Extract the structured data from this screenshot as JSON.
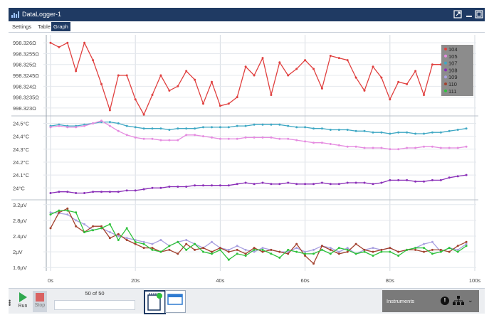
{
  "window": {
    "title": "DataLogger-1"
  },
  "tabs": [
    {
      "label": "Settings"
    },
    {
      "label": "Table"
    },
    {
      "label": "Graph"
    }
  ],
  "legend": {
    "entries": [
      {
        "id": "104",
        "color": "#e0403f"
      },
      {
        "id": "105",
        "color": "#e58ce0"
      },
      {
        "id": "107",
        "color": "#3fa8c4"
      },
      {
        "id": "108",
        "color": "#8a2fb8"
      },
      {
        "id": "109",
        "color": "#a9a0e0"
      },
      {
        "id": "110",
        "color": "#a3422f"
      },
      {
        "id": "111",
        "color": "#2ec23b"
      }
    ]
  },
  "bottom": {
    "run_label": "Run",
    "stop_label": "Stop",
    "count_text": "50 of 50",
    "instruments_label": "Instruments"
  },
  "chart_data": [
    {
      "type": "line",
      "ylabels": [
        "998.326Ω",
        "998.3255Ω",
        "998.325Ω",
        "998.3245Ω",
        "998.324Ω",
        "998.3235Ω",
        "998.323Ω"
      ],
      "ylim": [
        998.3228,
        998.3263
      ],
      "series": [
        {
          "name": "104",
          "color": "#e0403f",
          "x": [
            0,
            2,
            4,
            6,
            8,
            10,
            12,
            14,
            16,
            18,
            20,
            22,
            24,
            26,
            28,
            30,
            32,
            34,
            36,
            38,
            40,
            42,
            44,
            46,
            48,
            50,
            52,
            54,
            56,
            58,
            60,
            62,
            64,
            66,
            68,
            70,
            72,
            74,
            76,
            78,
            80,
            82,
            84,
            86,
            88,
            90,
            92,
            94,
            96,
            98
          ],
          "y": [
            998.326,
            998.3258,
            998.326,
            998.3247,
            998.326,
            998.3252,
            998.3241,
            998.3229,
            998.3245,
            998.3245,
            998.3234,
            998.3227,
            998.3236,
            998.3245,
            998.3238,
            998.324,
            998.3247,
            998.3243,
            998.3232,
            998.3242,
            998.3231,
            998.3232,
            998.3235,
            998.3249,
            998.3245,
            998.3253,
            998.3236,
            998.3251,
            998.3245,
            998.3248,
            998.3252,
            998.3248,
            998.3239,
            998.3254,
            998.3253,
            998.3252,
            998.3244,
            998.3238,
            998.3249,
            998.3244,
            998.3234,
            998.3242,
            998.3241,
            998.3247,
            998.3236,
            998.325,
            998.325,
            998.3252,
            998.3253,
            998.3243
          ]
        }
      ]
    },
    {
      "type": "line",
      "ylabels": [
        "24.5°C",
        "24.4°C",
        "24.3°C",
        "24.2°C",
        "24.1°C",
        "24°C"
      ],
      "ylim": [
        23.93,
        24.53
      ],
      "series": [
        {
          "name": "107",
          "color": "#3fa8c4",
          "x": [
            0,
            2,
            4,
            6,
            8,
            10,
            12,
            14,
            16,
            18,
            20,
            22,
            24,
            26,
            28,
            30,
            32,
            34,
            36,
            38,
            40,
            42,
            44,
            46,
            48,
            50,
            52,
            54,
            56,
            58,
            60,
            62,
            64,
            66,
            68,
            70,
            72,
            74,
            76,
            78,
            80,
            82,
            84,
            86,
            88,
            90,
            92,
            94,
            96,
            98
          ],
          "y": [
            24.48,
            24.49,
            24.48,
            24.48,
            24.49,
            24.5,
            24.51,
            24.51,
            24.5,
            24.48,
            24.47,
            24.46,
            24.46,
            24.46,
            24.45,
            24.46,
            24.46,
            24.46,
            24.47,
            24.47,
            24.47,
            24.47,
            24.48,
            24.48,
            24.49,
            24.49,
            24.49,
            24.49,
            24.48,
            24.47,
            24.47,
            24.46,
            24.46,
            24.45,
            24.45,
            24.45,
            24.44,
            24.44,
            24.43,
            24.43,
            24.42,
            24.43,
            24.43,
            24.42,
            24.42,
            24.43,
            24.43,
            24.44,
            24.45,
            24.46
          ]
        },
        {
          "name": "105",
          "color": "#e58ce0",
          "x": [
            0,
            2,
            4,
            6,
            8,
            10,
            12,
            14,
            16,
            18,
            20,
            22,
            24,
            26,
            28,
            30,
            32,
            34,
            36,
            38,
            40,
            42,
            44,
            46,
            48,
            50,
            52,
            54,
            56,
            58,
            60,
            62,
            64,
            66,
            68,
            70,
            72,
            74,
            76,
            78,
            80,
            82,
            84,
            86,
            88,
            90,
            92,
            94,
            96,
            98
          ],
          "y": [
            24.47,
            24.48,
            24.47,
            24.47,
            24.48,
            24.5,
            24.52,
            24.48,
            24.44,
            24.41,
            24.39,
            24.38,
            24.38,
            24.37,
            24.37,
            24.37,
            24.41,
            24.41,
            24.4,
            24.39,
            24.38,
            24.38,
            24.38,
            24.39,
            24.39,
            24.39,
            24.39,
            24.38,
            24.38,
            24.37,
            24.36,
            24.35,
            24.35,
            24.34,
            24.33,
            24.32,
            24.32,
            24.31,
            24.31,
            24.31,
            24.3,
            24.3,
            24.31,
            24.31,
            24.32,
            24.32,
            24.31,
            24.31,
            24.31,
            24.32
          ]
        },
        {
          "name": "108",
          "color": "#8a2fb8",
          "x": [
            0,
            2,
            4,
            6,
            8,
            10,
            12,
            14,
            16,
            18,
            20,
            22,
            24,
            26,
            28,
            30,
            32,
            34,
            36,
            38,
            40,
            42,
            44,
            46,
            48,
            50,
            52,
            54,
            56,
            58,
            60,
            62,
            64,
            66,
            68,
            70,
            72,
            74,
            76,
            78,
            80,
            82,
            84,
            86,
            88,
            90,
            92,
            94,
            96,
            98
          ],
          "y": [
            23.96,
            23.97,
            23.97,
            23.96,
            23.96,
            23.97,
            23.97,
            23.97,
            23.97,
            23.98,
            23.98,
            23.99,
            24.0,
            24.0,
            24.01,
            24.01,
            24.01,
            24.02,
            24.02,
            24.02,
            24.02,
            24.02,
            24.03,
            24.04,
            24.03,
            24.04,
            24.03,
            24.03,
            24.04,
            24.03,
            24.03,
            24.03,
            24.04,
            24.03,
            24.03,
            24.04,
            24.04,
            24.04,
            24.03,
            24.04,
            24.06,
            24.06,
            24.06,
            24.05,
            24.05,
            24.06,
            24.06,
            24.08,
            24.09,
            24.1
          ]
        }
      ]
    },
    {
      "type": "line",
      "ylabels": [
        "3.2µV",
        "2.8µV",
        "2.4µV",
        "2µV",
        "1.6µV"
      ],
      "ylim": [
        1.55,
        3.25
      ],
      "series": [
        {
          "name": "109",
          "color": "#a9a0e0",
          "x": [
            0,
            2,
            4,
            6,
            8,
            10,
            12,
            14,
            16,
            18,
            20,
            22,
            24,
            26,
            28,
            30,
            32,
            34,
            36,
            38,
            40,
            42,
            44,
            46,
            48,
            50,
            52,
            54,
            56,
            58,
            60,
            62,
            64,
            66,
            68,
            70,
            72,
            74,
            76,
            78,
            80,
            82,
            84,
            86,
            88,
            90,
            92,
            94,
            96,
            98
          ],
          "y": [
            3.0,
            2.98,
            2.95,
            2.8,
            2.7,
            2.55,
            2.6,
            2.5,
            2.4,
            2.35,
            2.3,
            2.25,
            2.2,
            2.3,
            2.15,
            2.25,
            2.3,
            2.2,
            2.1,
            2.25,
            2.1,
            2.05,
            2.15,
            2.05,
            2.0,
            2.1,
            2.05,
            2.0,
            2.0,
            2.1,
            2.0,
            2.05,
            2.15,
            2.1,
            2.0,
            2.1,
            1.95,
            2.05,
            2.1,
            2.05,
            2.1,
            2.0,
            2.05,
            2.1,
            2.2,
            2.25,
            2.0,
            2.1,
            2.05,
            2.2
          ]
        },
        {
          "name": "110",
          "color": "#a3422f",
          "x": [
            0,
            2,
            4,
            6,
            8,
            10,
            12,
            14,
            16,
            18,
            20,
            22,
            24,
            26,
            28,
            30,
            32,
            34,
            36,
            38,
            40,
            42,
            44,
            46,
            48,
            50,
            52,
            54,
            56,
            58,
            60,
            62,
            64,
            66,
            68,
            70,
            72,
            74,
            76,
            78,
            80,
            82,
            84,
            86,
            88,
            90,
            92,
            94,
            96,
            98
          ],
          "y": [
            2.6,
            3.0,
            3.1,
            2.65,
            2.5,
            2.65,
            2.65,
            2.35,
            2.45,
            2.3,
            2.2,
            2.1,
            2.1,
            2.0,
            2.05,
            1.95,
            2.2,
            2.05,
            2.1,
            2.0,
            2.1,
            2.0,
            2.05,
            1.95,
            2.1,
            2.0,
            2.05,
            2.0,
            1.95,
            2.2,
            1.9,
            1.7,
            2.15,
            2.05,
            1.95,
            2.0,
            2.2,
            2.05,
            2.0,
            2.05,
            2.1,
            2.0,
            2.05,
            2.05,
            2.0,
            2.05,
            2.05,
            2.0,
            2.15,
            2.25
          ]
        },
        {
          "name": "111",
          "color": "#2ec23b",
          "x": [
            0,
            2,
            4,
            6,
            8,
            10,
            12,
            14,
            16,
            18,
            20,
            22,
            24,
            26,
            28,
            30,
            32,
            34,
            36,
            38,
            40,
            42,
            44,
            46,
            48,
            50,
            52,
            54,
            56,
            58,
            60,
            62,
            64,
            66,
            68,
            70,
            72,
            74,
            76,
            78,
            80,
            82,
            84,
            86,
            88,
            90,
            92,
            94,
            96,
            98
          ],
          "y": [
            2.95,
            3.05,
            3.05,
            3.0,
            2.5,
            2.55,
            2.6,
            2.7,
            2.3,
            2.6,
            2.25,
            2.2,
            2.05,
            2.0,
            2.15,
            2.25,
            2.05,
            2.2,
            2.0,
            1.95,
            2.05,
            1.8,
            1.95,
            1.9,
            2.05,
            2.05,
            1.95,
            1.85,
            2.05,
            2.0,
            1.95,
            1.95,
            2.05,
            1.95,
            2.1,
            2.05,
            1.95,
            2.0,
            1.9,
            2.0,
            2.0,
            1.9,
            2.05,
            2.1,
            2.1,
            1.95,
            2.0,
            2.1,
            2.0,
            2.15
          ]
        }
      ]
    }
  ],
  "x_axis": {
    "ticks": [
      0,
      20,
      40,
      60,
      80,
      100
    ],
    "labels": [
      "0s",
      "20s",
      "40s",
      "60s",
      "80s",
      "100s"
    ],
    "xlim": [
      -1,
      100
    ]
  }
}
